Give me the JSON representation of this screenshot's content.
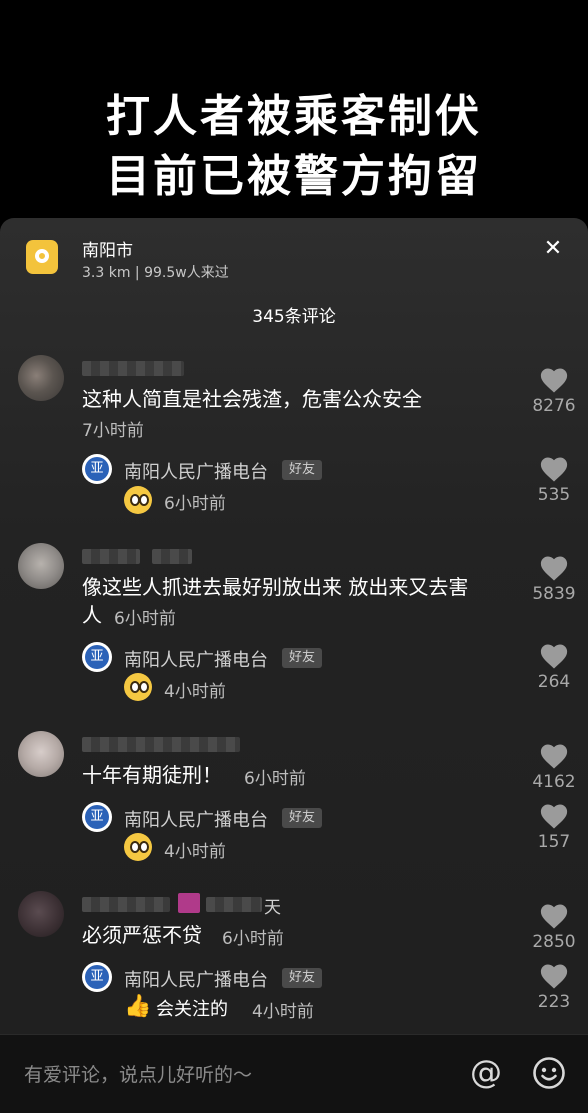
{
  "video": {
    "caption_line1": "打人者被乘客制伏",
    "caption_line2": "目前已被警方拘留"
  },
  "location": {
    "title": "南阳市",
    "subtitle": "3.3 km  |  99.5w人来过"
  },
  "close": "✕",
  "comments_count": "345条评论",
  "comments": [
    {
      "text": "这种人简直是社会残渣，危害公众安全",
      "time": "7小时前",
      "likes": "8276",
      "reply": {
        "name": "南阳人民广播电台",
        "badge": "好友",
        "text": "",
        "time": "6小时前",
        "likes": "535"
      }
    },
    {
      "text_line1": "像这些人抓进去最好别放出来 放出来又去害",
      "text_line2": "人",
      "time": "6小时前",
      "likes": "5839",
      "reply": {
        "name": "南阳人民广播电台",
        "badge": "好友",
        "text": "",
        "time": "4小时前",
        "likes": "264"
      }
    },
    {
      "text": "十年有期徒刑！",
      "time": "6小时前",
      "likes": "4162",
      "reply": {
        "name": "南阳人民广播电台",
        "badge": "好友",
        "text": "",
        "time": "4小时前",
        "likes": "157"
      }
    },
    {
      "username_suffix": "天",
      "text": "必须严惩不贷",
      "time": "6小时前",
      "likes": "2850",
      "reply": {
        "name": "南阳人民广播电台",
        "badge": "好友",
        "text": "会关注的",
        "time": "4小时前",
        "likes": "223"
      }
    }
  ],
  "input": {
    "placeholder": "有爱评论，说点儿好听的～",
    "at_symbol": "@"
  },
  "icons": [
    "location-pin-icon",
    "close-icon",
    "heart-icon",
    "at-icon",
    "smiley-icon",
    "thumbs-up-emoji",
    "pleading-face-emoji"
  ]
}
